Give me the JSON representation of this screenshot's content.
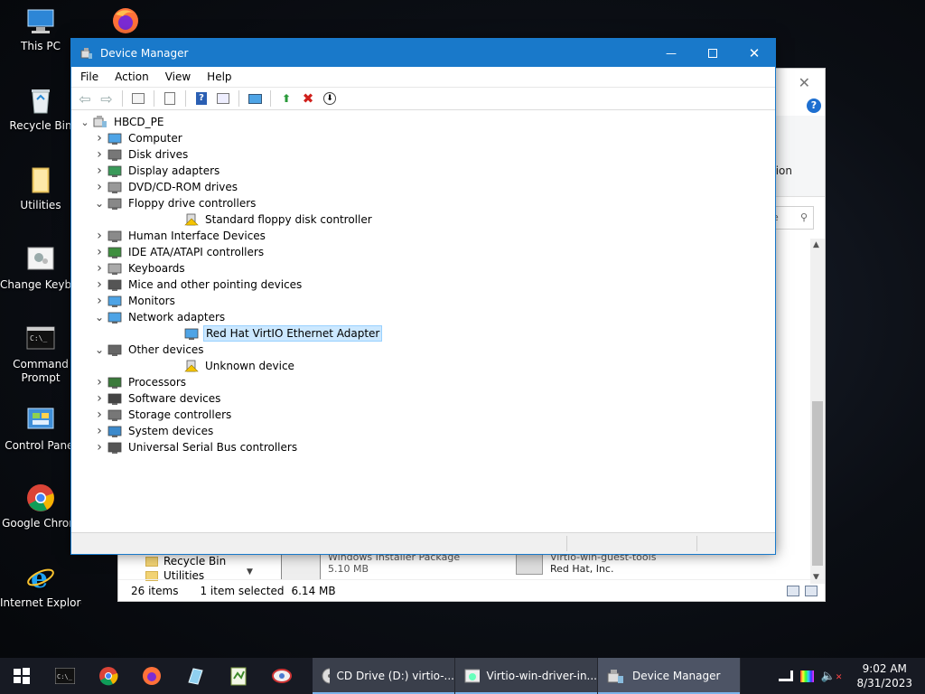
{
  "desktop": {
    "icons": [
      {
        "label": "This PC",
        "icon": "computer-icon"
      },
      {
        "label": "Recycle Bin",
        "icon": "recycle-bin-icon"
      },
      {
        "label": "Utilities",
        "icon": "folder-icon"
      },
      {
        "label": "Change Keyboard Layo",
        "icon": "keyboard-settings-icon"
      },
      {
        "label": "Command Prompt",
        "icon": "command-prompt-icon"
      },
      {
        "label": "Control Panel",
        "icon": "control-panel-icon"
      },
      {
        "label": "Google Chrom",
        "icon": "chrome-icon"
      },
      {
        "label": "Internet Explorer",
        "icon": "ie-icon"
      }
    ],
    "top_firefox": "firefox-icon"
  },
  "explorer": {
    "ribbon_text": "ction",
    "search_placeholder": "Se",
    "nav_items": [
      "Recycle Bin",
      "Utilities"
    ],
    "files": [
      {
        "name": "Windows Installer Package",
        "sub": "5.10 MB"
      },
      {
        "name": "Virtio-win-guest-tools",
        "sub": "Red Hat, Inc."
      }
    ],
    "status": {
      "items": "26 items",
      "selected": "1 item selected",
      "size": "6.14 MB"
    }
  },
  "devmgr": {
    "title": "Device Manager",
    "menu": [
      "File",
      "Action",
      "View",
      "Help"
    ],
    "tree": {
      "root": "HBCD_PE",
      "nodes": [
        {
          "label": "Computer",
          "expanded": false
        },
        {
          "label": "Disk drives",
          "expanded": false
        },
        {
          "label": "Display adapters",
          "expanded": false
        },
        {
          "label": "DVD/CD-ROM drives",
          "expanded": false
        },
        {
          "label": "Floppy drive controllers",
          "expanded": true
        },
        {
          "label": "Standard floppy disk controller",
          "child": true
        },
        {
          "label": "Human Interface Devices",
          "expanded": false
        },
        {
          "label": "IDE ATA/ATAPI controllers",
          "expanded": false
        },
        {
          "label": "Keyboards",
          "expanded": false
        },
        {
          "label": "Mice and other pointing devices",
          "expanded": false
        },
        {
          "label": "Monitors",
          "expanded": false
        },
        {
          "label": "Network adapters",
          "expanded": true
        },
        {
          "label": "Red Hat VirtIO Ethernet Adapter",
          "child": true,
          "selected": true
        },
        {
          "label": "Other devices",
          "expanded": true
        },
        {
          "label": "Unknown device",
          "child": true
        },
        {
          "label": "Processors",
          "expanded": false
        },
        {
          "label": "Software devices",
          "expanded": false
        },
        {
          "label": "Storage controllers",
          "expanded": false
        },
        {
          "label": "System devices",
          "expanded": false
        },
        {
          "label": "Universal Serial Bus controllers",
          "expanded": false
        }
      ]
    }
  },
  "taskbar": {
    "tasks": [
      {
        "label": "CD Drive (D:) virtio-...",
        "icon": "cd-drive-icon"
      },
      {
        "label": "Virtio-win-driver-in...",
        "icon": "installer-icon"
      },
      {
        "label": "Device Manager",
        "icon": "device-manager-icon"
      }
    ],
    "clock": {
      "time": "9:02 AM",
      "date": "8/31/2023"
    }
  },
  "colors": {
    "titlebar": "#1979ca",
    "selection": "#cce8ff",
    "taskbar": "#171a23"
  }
}
